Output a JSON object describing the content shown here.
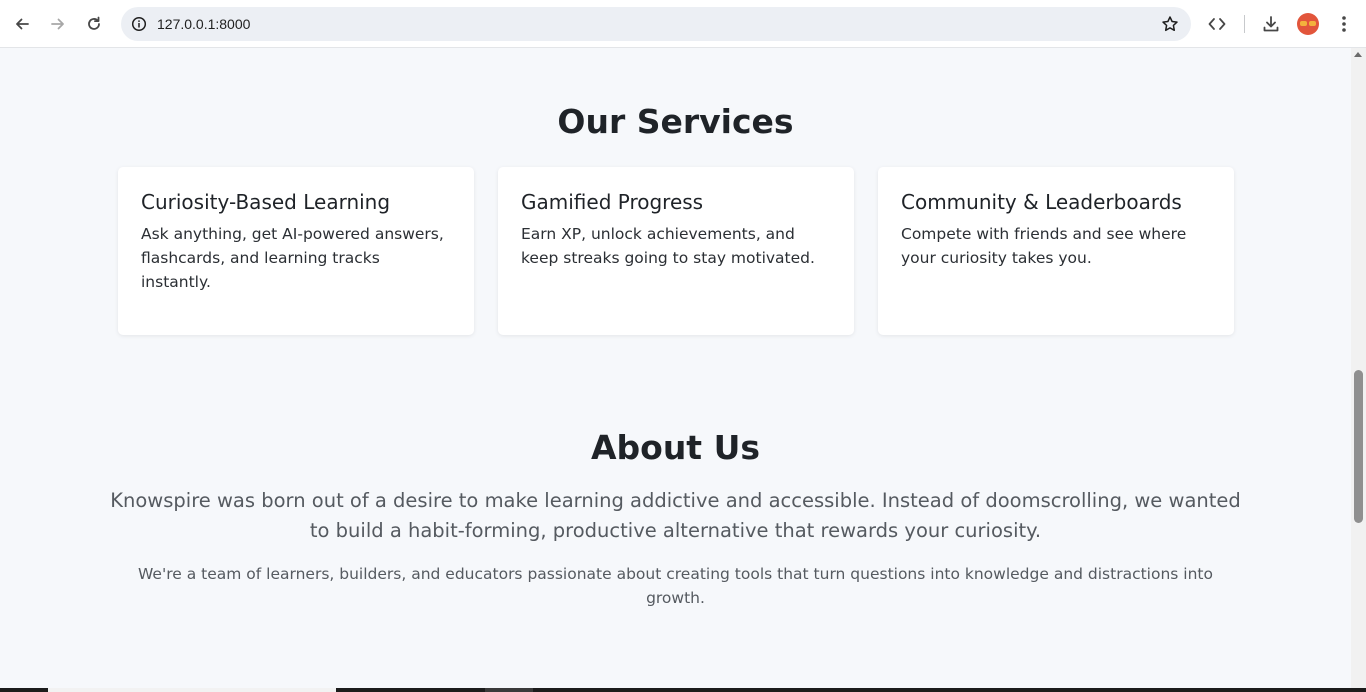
{
  "browser": {
    "url": "127.0.0.1:8000",
    "icons": [
      "back-icon",
      "forward-icon",
      "reload-icon",
      "site-info-icon",
      "bookmark-star-icon",
      "devtools-code-icon",
      "download-icon",
      "profile-avatar",
      "menu-dots-icon"
    ]
  },
  "services": {
    "title": "Our Services",
    "cards": [
      {
        "title": "Curiosity-Based Learning",
        "text": "Ask anything, get AI-powered answers, flashcards, and learning tracks instantly."
      },
      {
        "title": "Gamified Progress",
        "text": "Earn XP, unlock achievements, and keep streaks going to stay motivated."
      },
      {
        "title": "Community & Leaderboards",
        "text": "Compete with friends and see where your curiosity takes you."
      }
    ]
  },
  "about": {
    "title": "About Us",
    "lead": "Knowspire was born out of a desire to make learning addictive and accessible. Instead of doomscrolling, we wanted to build a habit-forming, productive alternative that rewards your curiosity.",
    "sub": "We're a team of learners, builders, and educators passionate about creating tools that turn questions into knowledge and distractions into growth."
  }
}
